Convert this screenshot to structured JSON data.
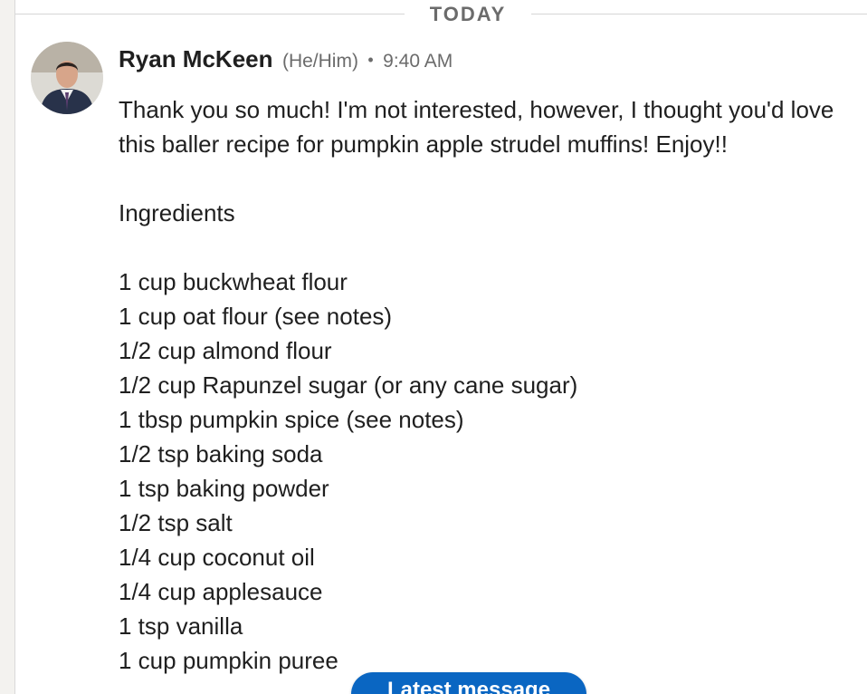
{
  "divider": {
    "label": "TODAY"
  },
  "message": {
    "sender_name": "Ryan McKeen",
    "pronouns": "(He/Him)",
    "separator": "•",
    "time": "9:40 AM",
    "intro": "Thank you so much! I'm not interested, however, I thought you'd love this baller recipe for pumpkin apple strudel muffins! Enjoy!!",
    "ingredients_heading": "Ingredients",
    "ingredients": [
      "1 cup buckwheat flour",
      "1 cup oat flour (see notes)",
      "1/2 cup almond flour",
      "1/2 cup Rapunzel sugar (or any cane sugar)",
      "1 tbsp pumpkin spice (see notes)",
      "1/2 tsp baking soda",
      "1 tsp baking powder",
      "1/2 tsp salt",
      "1/4 cup coconut oil",
      "1/4 cup applesauce",
      "1 tsp vanilla",
      "1 cup pumpkin puree"
    ]
  },
  "latest_button": {
    "label": "Latest message"
  },
  "colors": {
    "accent": "#0a66c2",
    "text": "#1f1f1f",
    "muted": "#6b6b6b",
    "divider": "#d6d6d6"
  },
  "icons": {
    "avatar": "profile-photo"
  }
}
